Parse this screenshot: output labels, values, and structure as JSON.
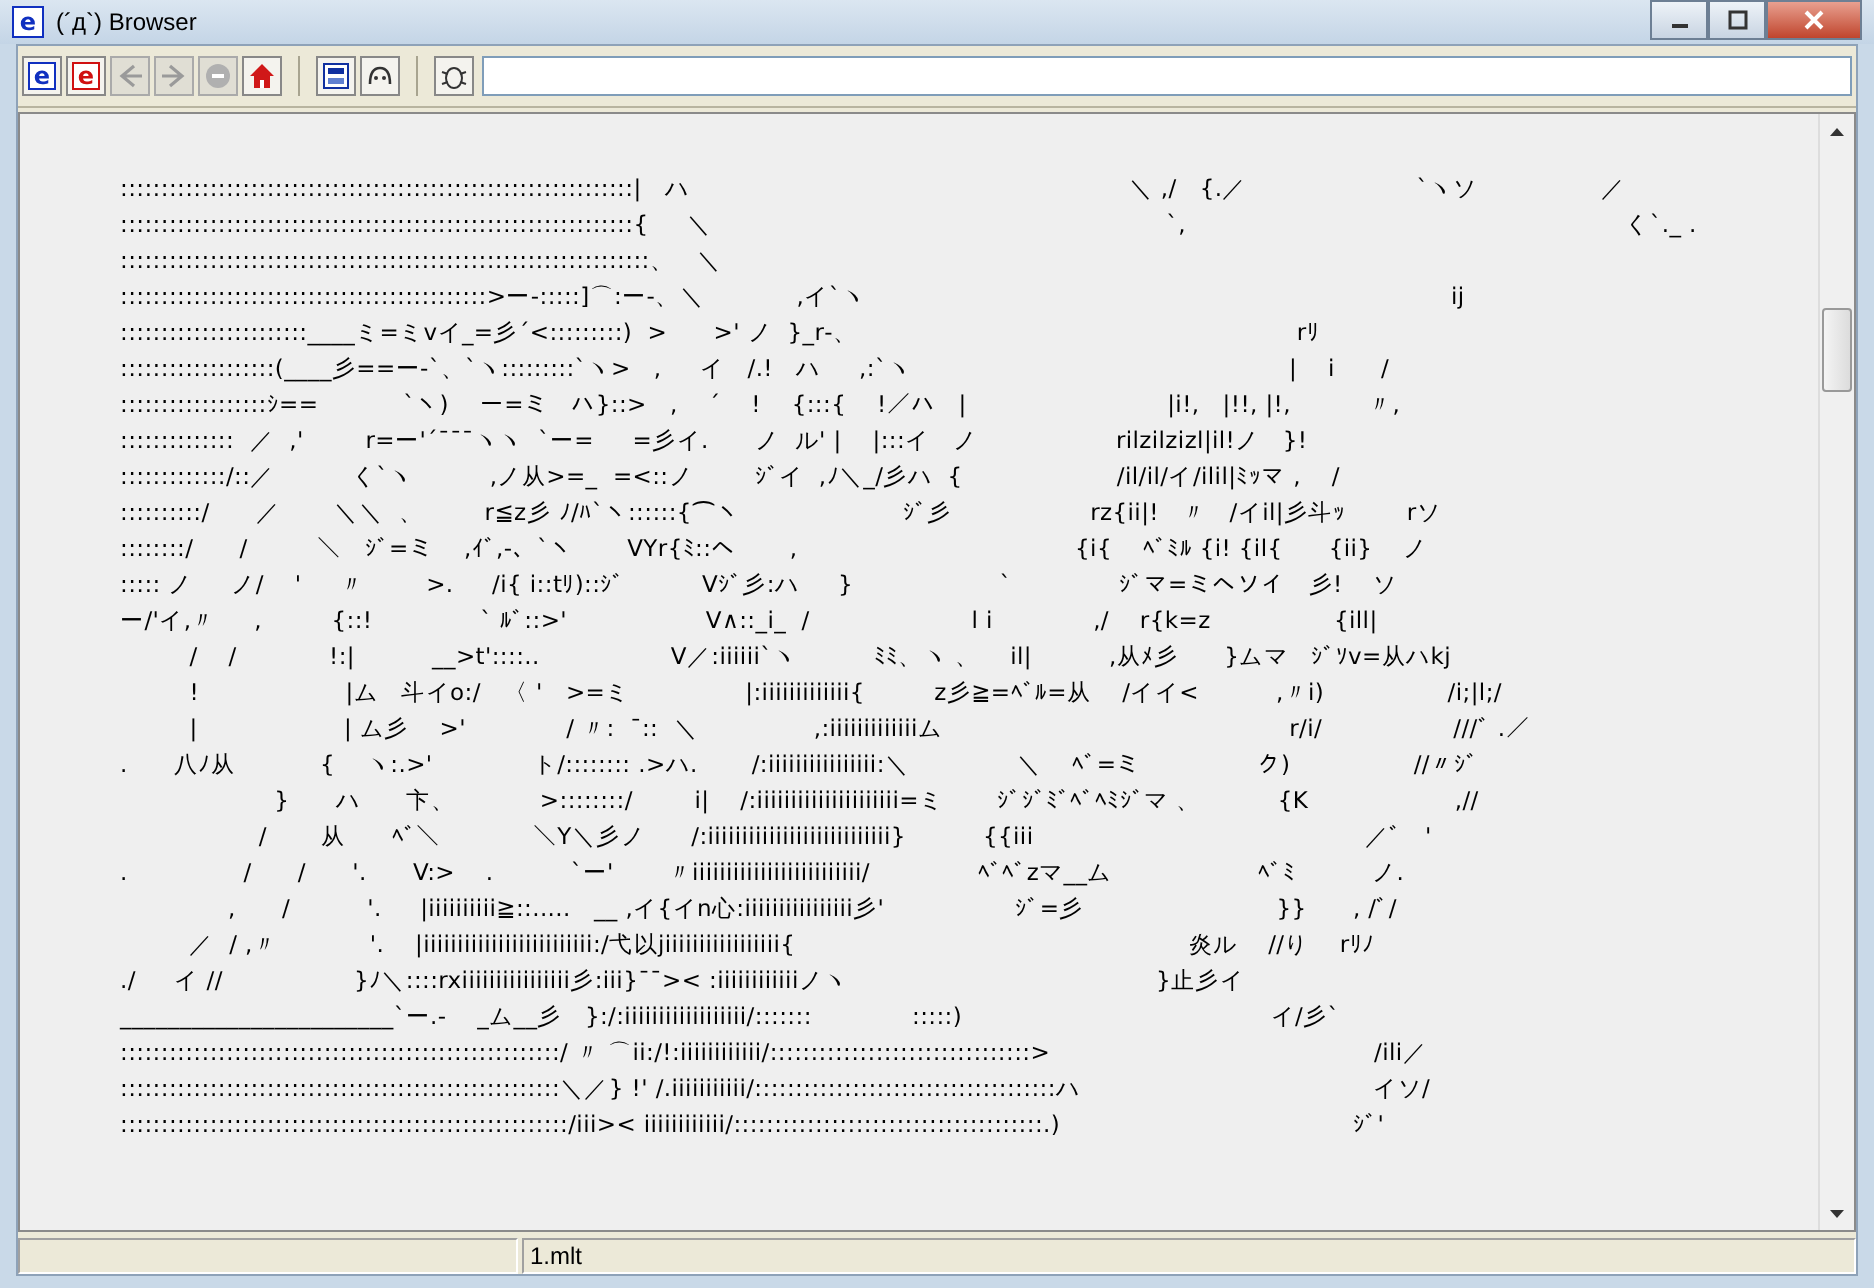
{
  "window": {
    "title": "(´д`) Browser",
    "icon_glyph": "e"
  },
  "toolbar": [
    {
      "kind": "letter",
      "glyph": "e",
      "color": "#1030c0",
      "disabled": false
    },
    {
      "kind": "letter",
      "glyph": "e",
      "color": "#d01010",
      "disabled": false
    },
    {
      "kind": "back",
      "disabled": true
    },
    {
      "kind": "forward",
      "disabled": true
    },
    {
      "kind": "stop",
      "disabled": true
    },
    {
      "kind": "home",
      "disabled": false
    },
    {
      "kind": "sep"
    },
    {
      "kind": "frames",
      "disabled": false
    },
    {
      "kind": "face",
      "disabled": false
    },
    {
      "kind": "sep"
    },
    {
      "kind": "bug",
      "disabled": false
    }
  ],
  "art_lines": [
    ":::::::::::::::::::::::::::::::::::::::::::::::::::::::::::::::|   ハ                                                         ＼ ,/   {.／                      `ヽソ                ／",
    ":::::::::::::::::::::::::::::::::::::::::::::::::::::::::::::::{     ＼                                                           `,                                                         く`._ .",
    ":::::::::::::::::::::::::::::::::::::::::::::::::::::::::::::::::、   ＼",
    ":::::::::::::::::::::::::::::::::::::::::::::>ー-:::::]⌒:ー-、＼            ,イ`ヽ                                                                            ij",
    ":::::::::::::::::::::::____ミ=ミvイ_=彡´<:::::::::)  >      >' ノ  }_r‐、                                                         rﾘ",
    ":::::::::::::::::::(____彡==ー-`、`ヽ:::::::::`ヽ>   ,     イ   /.!   ハ     ,:`ヽ                                                 |    i      /",
    "::::::::::::::::::ｼ==           `ヽ)    ー=ミ   ハ}::>   ,    ´    !    {:::{    !／ハ   |                          |i!,   |!!, |!,          〃,",
    "::::::::::::::  ／  ,'        r=ー'´¯¯¯ヽヽ  `ー=     =彡イ.      ノ  ル' |    |:::イ   ノ                  rilzilzizl|il!ノ   }!",
    ":::::::::::::/::／          く`ヽ          ,ノ从>=_  =<::ノ        ｼﾞイ  ,ﾉ＼_/彡ハ  {                    /il/il/イ/ilil|ﾐｯマ ,    /",
    "::::::::::/      ／       ＼＼  、        r≦z彡 ﾉ/ﾊ`ヽ::::::{⌒ヽ                     ｼﾞ彡                  rz{ii|!   〃   /イil|彡斗ｯ        rソ",
    "::::::::/      /         ＼   ｼﾞ=ミ    ,ｲﾞ,-、`ヽ       VYr{ﾐ::ヘ       ,                                    {i{    ﾍﾞﾐﾙ {i! {il{      {ii}    ノ",
    "::::: ノ     ノ/    '     〃        >.     /i{ i::tﾘ)::ｼﾞ          Vｼﾞ彡:ハ     }                   `              ｼﾞマ=ミヘソイ   彡!    ソ",
    "ー/'イ,〃     ,         {::!              ` ﾙﾞ::>'                  V∧::_i_  /                     l i             ,/    r{k=z                {ill|",
    "         /    /            !:|          __>t'::::..                 V／:iiiiii`ヽ          ﾐﾐ、ヽ 、    il|          ,从ﾒ彡      }ムマ   ｼﾞｿv=从ハkj",
    "         !                   |ム   斗イo:/   〈 '   >=ミ               |:iiiiiiiiiiiii{         z彡≧=ﾍﾞﾙ=从    /イイ<          ,〃i)                /i;|l;/",
    "         |                   | ム彡    >'             / 〃:  ¯::  ＼               ,:iiiiiiiiiiiiiム                                             r/i/                 ///ﾞ .／",
    ".      八ﾉ从           {    ヽ:.>'             ト/:::::::: .>ハ.       /:iiiiiiiiiiiiiiii:＼              ＼    ﾍﾞ=ミ               ク)                //〃ｼﾞ",
    "                    }      ハ      卞、           >::::::::/        i|    /:iiiiiiiiiiiiiiiiiiiii=ミ       ｼﾞｼﾞﾐﾞﾍﾞﾍﾐｼﾞマ 、          {K                   ,//",
    "                  /       从      ﾍﾞ＼            ＼Y＼彡ノ      /:iiiiiiiiiiiiiiiiiiiiiiiiiii}          {{iii                                           ／ﾞ   '",
    ".               /      /      '.      V:>    .          `ー'       〃iiiiiiiiiiiiiiiiiiiiiiiii/              ﾍﾞﾍﾞzマ__ム                   ﾍﾞﾐ          ノ.",
    "              ,      /          '.     |iiiiiiiiii≧::.....   __ ,イ{イn心:iiiiiiiiiiiiiiii彡'                 ｼﾞ=彡                         }}      , /ﾞ/",
    "         ／  / ,〃            '.    |iiiiiiiiiiiiiiiiiiiiiiiii:/弋以jiiiiiiiiiiiiiiiii{                                                   炎ル    //り    rﾘﾉ",
    "./     イ //                 }ﾉ＼::::rxiiiiiiiiiiiiiiii彡:iii}¯¯>< :iiiiiiiiiiiiノヽ                                        }止彡イ",
    "_______________________`ー.-    _ム__彡   }:/:iiiiiiiiiiiiiiiiii/:::::::             :::::)                                        イ/彡`",
    "::::::::::::::::::::::::::::::::::::::::::::::::::::::/ 〃 ⌒ii:/!:iiiiiiiiiiii/::::::::::::::::::::::::::::::::>                                          /ili／",
    "::::::::::::::::::::::::::::::::::::::::::::::::::::::＼／} !' /.iiiiiiiiiii/:::::::::::::::::::::::::::::::::::::ハ                                      イソ/",
    ":::::::::::::::::::::::::::::::::::::::::::::::::::::::/iii>< iiiiiiiiiiii/::::::::::::::::::::::::::::::::::::::.)                                      ｼﾞ'"
  ],
  "status_bar": {
    "file": "1.mlt"
  }
}
